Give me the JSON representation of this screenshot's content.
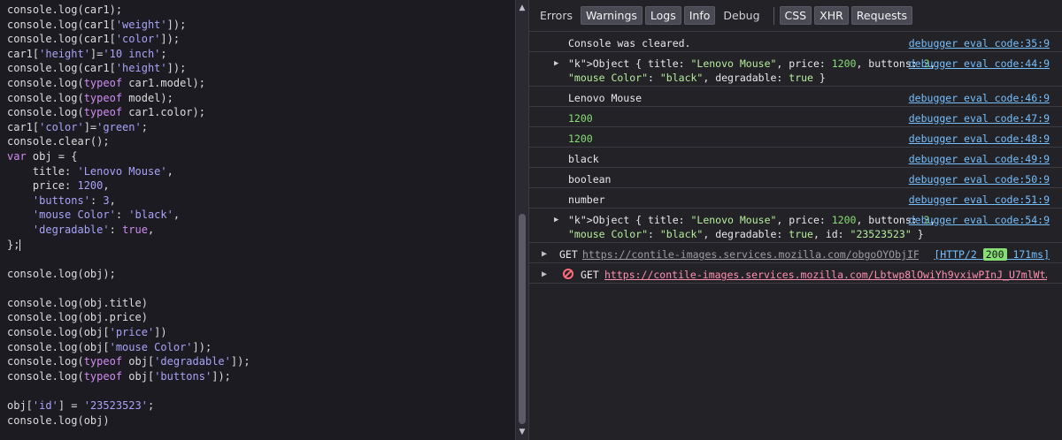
{
  "editor": {
    "lines": [
      [
        {
          "t": "console.log(car1);",
          "c": "plain"
        }
      ],
      [
        {
          "t": "console.log(car1[",
          "c": "plain"
        },
        {
          "t": "'weight'",
          "c": "str"
        },
        {
          "t": "]);",
          "c": "plain"
        }
      ],
      [
        {
          "t": "console.log(car1[",
          "c": "plain"
        },
        {
          "t": "'color'",
          "c": "str"
        },
        {
          "t": "]);",
          "c": "plain"
        }
      ],
      [
        {
          "t": "car1[",
          "c": "plain"
        },
        {
          "t": "'height'",
          "c": "str"
        },
        {
          "t": "]=",
          "c": "plain"
        },
        {
          "t": "'10 inch'",
          "c": "str"
        },
        {
          "t": ";",
          "c": "plain"
        }
      ],
      [
        {
          "t": "console.log(car1[",
          "c": "plain"
        },
        {
          "t": "'height'",
          "c": "str"
        },
        {
          "t": "]);",
          "c": "plain"
        }
      ],
      [
        {
          "t": "console.log(",
          "c": "plain"
        },
        {
          "t": "typeof",
          "c": "kw"
        },
        {
          "t": " car1.model);",
          "c": "plain"
        }
      ],
      [
        {
          "t": "console.log(",
          "c": "plain"
        },
        {
          "t": "typeof",
          "c": "kw"
        },
        {
          "t": " model);",
          "c": "plain"
        }
      ],
      [
        {
          "t": "console.log(",
          "c": "plain"
        },
        {
          "t": "typeof",
          "c": "kw"
        },
        {
          "t": " car1.color);",
          "c": "plain"
        }
      ],
      [
        {
          "t": "car1[",
          "c": "plain"
        },
        {
          "t": "'color'",
          "c": "str"
        },
        {
          "t": "]=",
          "c": "plain"
        },
        {
          "t": "'green'",
          "c": "str"
        },
        {
          "t": ";",
          "c": "plain"
        }
      ],
      [
        {
          "t": "console.clear();",
          "c": "plain"
        }
      ],
      [
        {
          "t": "var",
          "c": "kw"
        },
        {
          "t": " obj = {",
          "c": "plain"
        }
      ],
      [
        {
          "t": "    title: ",
          "c": "plain"
        },
        {
          "t": "'Lenovo Mouse'",
          "c": "str"
        },
        {
          "t": ",",
          "c": "plain"
        }
      ],
      [
        {
          "t": "    price: ",
          "c": "plain"
        },
        {
          "t": "1200",
          "c": "num"
        },
        {
          "t": ",",
          "c": "plain"
        }
      ],
      [
        {
          "t": "    ",
          "c": "plain"
        },
        {
          "t": "'buttons'",
          "c": "str"
        },
        {
          "t": ": ",
          "c": "plain"
        },
        {
          "t": "3",
          "c": "num"
        },
        {
          "t": ",",
          "c": "plain"
        }
      ],
      [
        {
          "t": "    ",
          "c": "plain"
        },
        {
          "t": "'mouse Color'",
          "c": "str"
        },
        {
          "t": ": ",
          "c": "plain"
        },
        {
          "t": "'black'",
          "c": "str"
        },
        {
          "t": ",",
          "c": "plain"
        }
      ],
      [
        {
          "t": "    ",
          "c": "plain"
        },
        {
          "t": "'degradable'",
          "c": "str"
        },
        {
          "t": ": ",
          "c": "plain"
        },
        {
          "t": "true",
          "c": "kw"
        },
        {
          "t": ",",
          "c": "plain"
        }
      ],
      [
        {
          "t": "};",
          "c": "plain",
          "cursor": true
        }
      ],
      [],
      [
        {
          "t": "console.log(obj);",
          "c": "plain"
        }
      ],
      [],
      [
        {
          "t": "console.log(obj.title)",
          "c": "plain"
        }
      ],
      [
        {
          "t": "console.log(obj.price)",
          "c": "plain"
        }
      ],
      [
        {
          "t": "console.log(obj[",
          "c": "plain"
        },
        {
          "t": "'price'",
          "c": "str"
        },
        {
          "t": "])",
          "c": "plain"
        }
      ],
      [
        {
          "t": "console.log(obj[",
          "c": "plain"
        },
        {
          "t": "'mouse Color'",
          "c": "str"
        },
        {
          "t": "]);",
          "c": "plain"
        }
      ],
      [
        {
          "t": "console.log(",
          "c": "plain"
        },
        {
          "t": "typeof",
          "c": "kw"
        },
        {
          "t": " obj[",
          "c": "plain"
        },
        {
          "t": "'degradable'",
          "c": "str"
        },
        {
          "t": "]);",
          "c": "plain"
        }
      ],
      [
        {
          "t": "console.log(",
          "c": "plain"
        },
        {
          "t": "typeof",
          "c": "kw"
        },
        {
          "t": " obj[",
          "c": "plain"
        },
        {
          "t": "'buttons'",
          "c": "str"
        },
        {
          "t": "]);",
          "c": "plain"
        }
      ],
      [],
      [
        {
          "t": "obj[",
          "c": "plain"
        },
        {
          "t": "'id'",
          "c": "str"
        },
        {
          "t": "] = ",
          "c": "plain"
        },
        {
          "t": "'23523523'",
          "c": "str"
        },
        {
          "t": ";",
          "c": "plain"
        }
      ],
      [
        {
          "t": "console.log(obj)",
          "c": "plain"
        }
      ]
    ]
  },
  "toolbar": {
    "filters": [
      {
        "label": "Errors",
        "on": false
      },
      {
        "label": "Warnings",
        "on": true
      },
      {
        "label": "Logs",
        "on": true
      },
      {
        "label": "Info",
        "on": true
      },
      {
        "label": "Debug",
        "on": false
      }
    ],
    "types": [
      {
        "label": "CSS",
        "on": true
      },
      {
        "label": "XHR",
        "on": true
      },
      {
        "label": "Requests",
        "on": true
      }
    ]
  },
  "console": {
    "cleared": {
      "text": "Console was cleared.",
      "src": "debugger eval code:35:9"
    },
    "obj1": {
      "line1": "Object { title: \"Lenovo Mouse\", price: 1200, buttons: 3,",
      "line2": "\"mouse Color\": \"black\", degradable: true }",
      "src": "debugger eval code:44:9"
    },
    "logs": [
      {
        "text": "Lenovo Mouse",
        "kind": "text",
        "src": "debugger eval code:46:9"
      },
      {
        "text": "1200",
        "kind": "num",
        "src": "debugger eval code:47:9"
      },
      {
        "text": "1200",
        "kind": "num",
        "src": "debugger eval code:48:9"
      },
      {
        "text": "black",
        "kind": "text",
        "src": "debugger eval code:49:9"
      },
      {
        "text": "boolean",
        "kind": "text",
        "src": "debugger eval code:50:9"
      },
      {
        "text": "number",
        "kind": "text",
        "src": "debugger eval code:51:9"
      }
    ],
    "obj2": {
      "line1": "Object { title: \"Lenovo Mouse\", price: 1200, buttons: 3,",
      "line2": "\"mouse Color\": \"black\", degradable: true, id: \"23523523\" }",
      "src": "debugger eval code:54:9"
    },
    "net1": {
      "method": "GET",
      "url": "https://contile-images.services.mozilla.com/obgoOYObjIFe…",
      "protocol": "[HTTP/2 ",
      "status": "200",
      "time": " 171ms]"
    },
    "net2": {
      "method": "GET",
      "url": "https://contile-images.services.mozilla.com/Lbtwp8lOwiYh9vxiwPInJ_U7mlWt…"
    }
  },
  "colors": {
    "accent": "#75bfff",
    "number": "#86de74",
    "error": "#ff6b7d"
  }
}
